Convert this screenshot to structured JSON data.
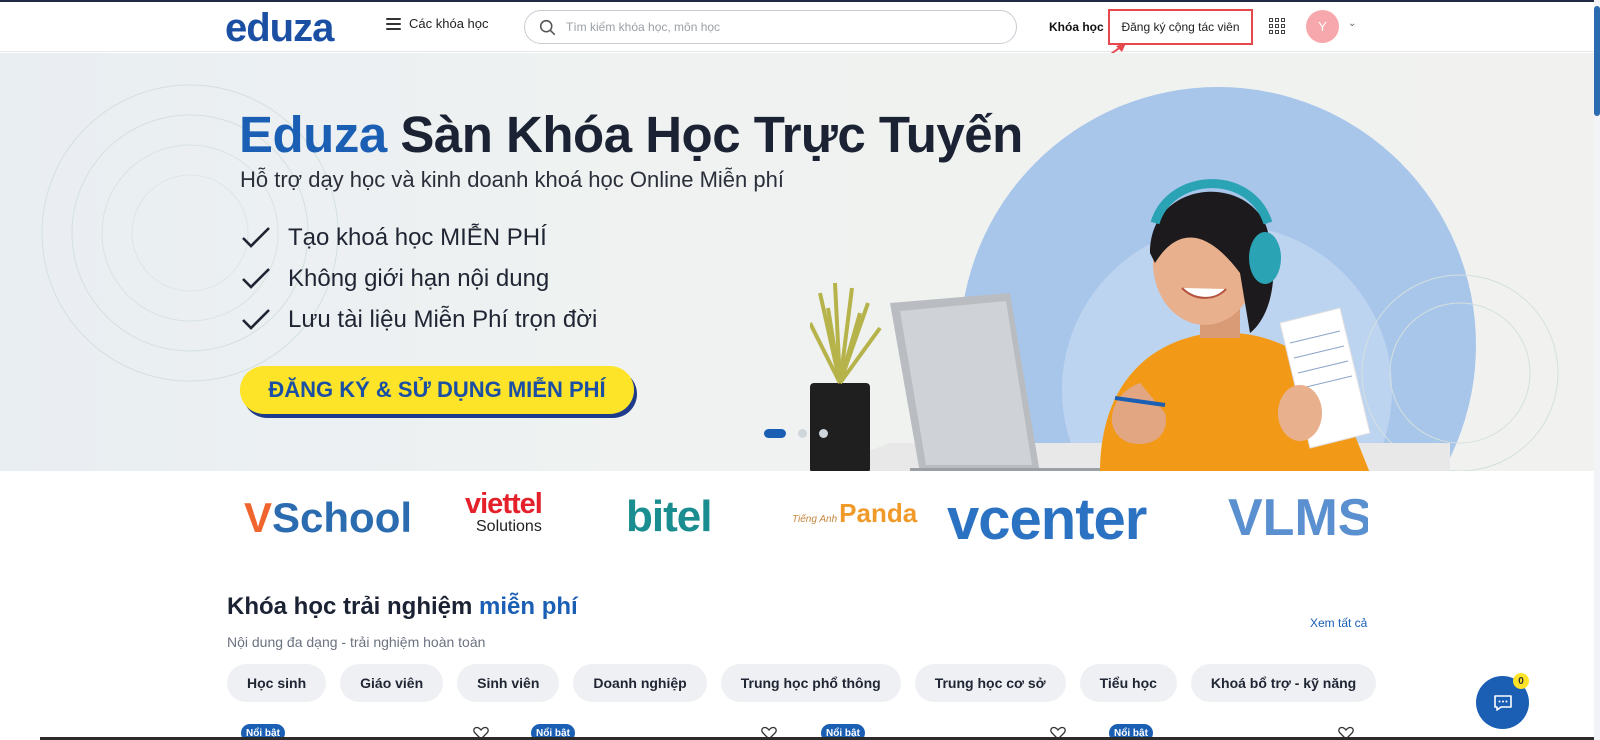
{
  "header": {
    "logo": "eduza",
    "menu_label": "Các khóa học",
    "search_placeholder": "Tìm kiếm khóa học, môn học",
    "nav_courses": "Khóa học",
    "nav_register_affiliate": "Đăng ký cộng tác viên",
    "avatar_initial": "Y",
    "avatar_color": "#f7a8ad",
    "annotation_color": "#e5484d"
  },
  "hero": {
    "title_brand": "Eduza",
    "title_rest": " Sàn Khóa Học Trực Tuyến",
    "subtitle": "Hỗ trợ dạy học và kinh doanh khoá học Online Miễn phí",
    "features": [
      "Tạo khoá học MIỄN PHÍ",
      "Không giới hạn nội dung",
      "Lưu tài liệu Miễn Phí trọn đời"
    ],
    "cta_label": "ĐĂNG KÝ & SỬ DỤNG MIỄN PHÍ",
    "slide_count": 3,
    "active_slide": 0,
    "accent": "#1a5fb4",
    "cta_color": "#fde428"
  },
  "partners": {
    "vschool_v": "V",
    "vschool_rest": "School",
    "viettel": "viettel",
    "viettel_sub": "Solutions",
    "bitel": "bitel",
    "panda_prefix": "Tiếng Anh",
    "panda": "Panda",
    "vcenter": "vcenter",
    "vlms": "VLMS"
  },
  "section": {
    "title_main": "Khóa học trải nghiệm ",
    "title_highlight": "miễn phí",
    "subtitle": "Nội dung đa dạng - trải nghiệm hoàn toàn",
    "see_all": "Xem tất cả",
    "categories": [
      "Học sinh",
      "Giáo viên",
      "Sinh viên",
      "Doanh nghiệp",
      "Trung học phổ thông",
      "Trung học cơ sở",
      "Tiểu học",
      "Khoá bổ trợ - kỹ năng"
    ],
    "card_badge": "Nổi bật"
  },
  "chat": {
    "icon": "chat-icon",
    "unread": "0"
  }
}
